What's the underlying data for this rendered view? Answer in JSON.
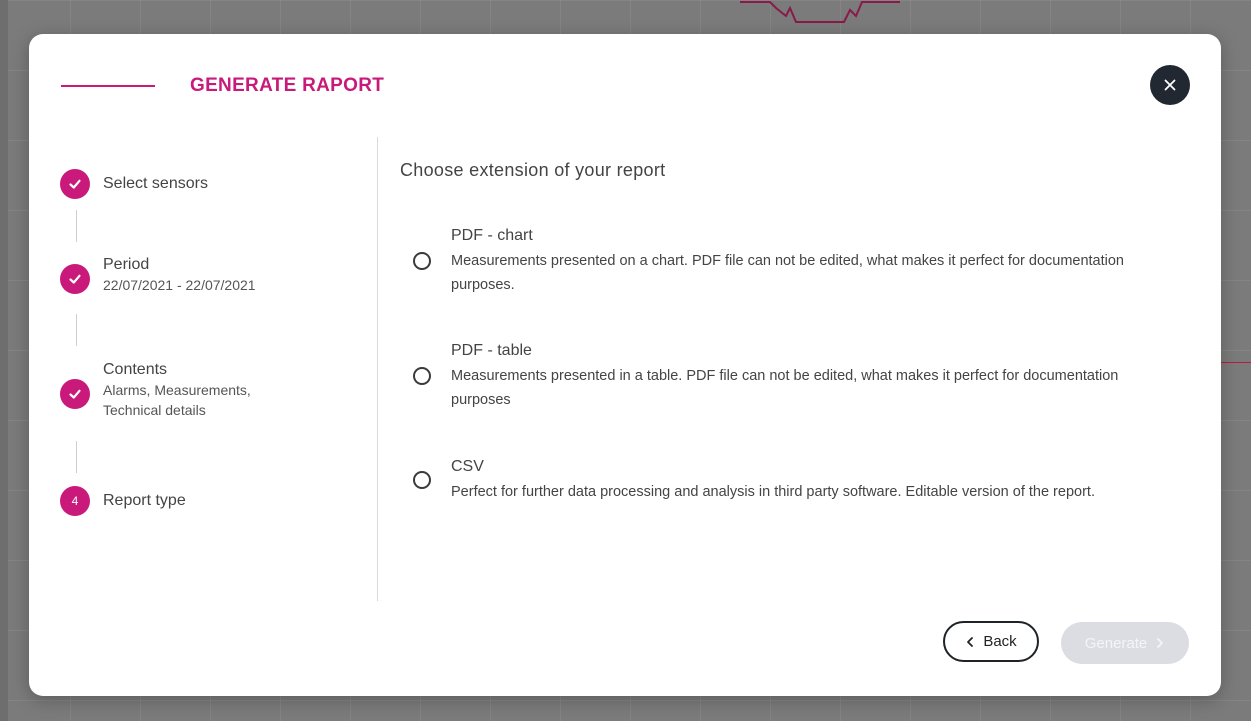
{
  "modal": {
    "title": "GENERATE RAPORT",
    "close_icon": "close-icon"
  },
  "stepper": {
    "steps": [
      {
        "label": "Select sensors",
        "sub": "",
        "state": "done"
      },
      {
        "label": "Period",
        "sub": "22/07/2021 - 22/07/2021",
        "state": "done"
      },
      {
        "label": "Contents",
        "sub_lines": [
          "Alarms, Measurements,",
          "Technical details"
        ],
        "state": "done"
      },
      {
        "label": "Report type",
        "number": "4",
        "state": "current"
      }
    ]
  },
  "content": {
    "heading": "Choose extension of your report",
    "options": [
      {
        "title": "PDF - chart",
        "description": "Measurements presented on a chart. PDF file can not be edited, what makes it perfect for documentation purposes."
      },
      {
        "title": "PDF - table",
        "description": "Measurements presented in a table. PDF file can not be edited, what makes it perfect for documentation purposes"
      },
      {
        "title": "CSV",
        "description": "Perfect for further data processing and analysis in third party software. Editable version of the report."
      }
    ]
  },
  "footer": {
    "back_label": "Back",
    "generate_label": "Generate"
  },
  "colors": {
    "accent": "#c91a7b",
    "dark": "#222832",
    "disabled": "#dcdce3"
  }
}
